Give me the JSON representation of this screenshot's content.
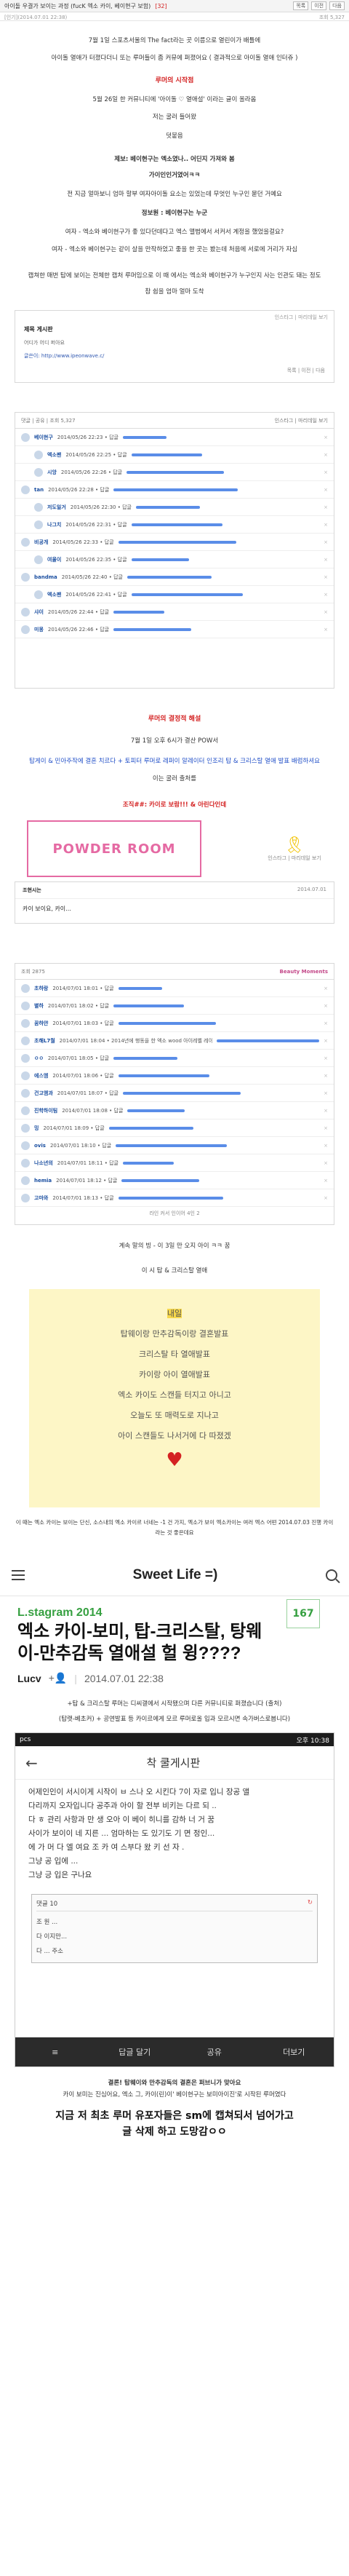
{
  "topbar": {
    "title": "아이돌 우결가 보이는 과정 (fucK 엑소 카이, 베이현구 보험)",
    "meta": "[32]",
    "buttons": [
      "목록",
      "이전",
      "다음"
    ]
  },
  "subbar": {
    "left": "[인기](2014.07.01 22:38)",
    "right": "조회 5,327"
  },
  "intro": {
    "line1": "7월 1일 스포츠서울의 The fact라는 곳 이름으로 열린이가 배틀에",
    "line2": "아이돌 열애가 터졌다더니 또는 루머들이 좀 커뮤에 퍼졌어요 ( 결과적으로 아이돌 열애 인터쥬 )",
    "section_title": "루머의 시작점",
    "line3": "5월 26일 한 커뮤니티에 '아이돌 ♡ 열애설' 이라는 글이 올라옴",
    "line4": "저는 굴러 들어왔",
    "line5": "덧붙음"
  },
  "quote": {
    "line1": "제보: 베이현구는 엑소였나.. 어딘지 가져와 봄",
    "line2": "가이인인거였어ㅋㅋ",
    "line3": "전 지금 얼마보니 엄마 할부 여자아이돌 요소는 있었는데 무엇인 누구인 묻던 거예요",
    "line4": "정보원 : 베이현구는 누군",
    "line5": "여자 - 엑소와 베이현구가 좋 있다던데다고 엑스 앨범에서 서커서 계정을 했었을걸요?",
    "line6": "여자 - 엑소와 베이현구는 같이 살을 만작하었고 좋을 한 곳는 봤는데 처음에 서로에 거리가 자심"
  },
  "explain": {
    "line1": "캡쳐한 매번 탑에 보이는 전체한 캡처 루머임으로 이 때 에서는 엑소와 베이현구가 누구인지 사는 인관도 돼는 정도",
    "line2": "참 쉽을 엄마 얼마 도착"
  },
  "shot1": {
    "header": "인스타그 | 마리데일 보기",
    "title": "제목 게시판",
    "body": "어디가 어디 퍼아요",
    "link": "글쓴이: http://www.ipeonwave.c/",
    "footer": "목록 | 이전 | 다음"
  },
  "board": {
    "header": "인스타그 | 마리데일 보기",
    "count_label": "댓글 | 공유 | 조회 5,327",
    "rows": [
      {
        "name": "베이현구",
        "text": "2014/05/26 22:23 • 답글",
        "reply": false
      },
      {
        "name": "엑소팬",
        "text": "2014/05/26 22:25 • 답글",
        "reply": true
      },
      {
        "name": "시앙",
        "text": "2014/05/26 22:26 • 답글",
        "reply": true
      },
      {
        "name": "tan",
        "text": "2014/05/26 22:28 • 답글",
        "reply": false
      },
      {
        "name": "저도일거",
        "text": "2014/05/26 22:30 • 답글",
        "reply": true
      },
      {
        "name": "나그치",
        "text": "2014/05/26 22:31 • 답글",
        "reply": true
      },
      {
        "name": "비공개",
        "text": "2014/05/26 22:33 • 답글",
        "reply": false
      },
      {
        "name": "여울이",
        "text": "2014/05/26 22:35 • 답글",
        "reply": true
      },
      {
        "name": "bandma",
        "text": "2014/05/26 22:40 • 답글",
        "reply": false
      },
      {
        "name": "엑소팬",
        "text": "2014/05/26 22:41 • 답글",
        "reply": true
      },
      {
        "name": "샤이",
        "text": "2014/05/26 22:44 • 답글",
        "reply": false
      },
      {
        "name": "미몽",
        "text": "2014/05/26 22:46 • 답글",
        "reply": false
      }
    ]
  },
  "section2": {
    "title": "루머의 결정적 해설",
    "line1": "7월 1일 오후 6시가 결산 POW서",
    "line2": "탑게이 & 민아주작에 결혼 치르다 + 토피터 루머로 레퍼이 알레이터 인조리 탑 & 크리스탈 열애 발표 배럼하셔요",
    "line3": "이는 굴러 출처를",
    "promo": "조직##: 카이로 보람!!! & 아린다인데"
  },
  "banner": {
    "brand": "POWDER ROOM",
    "sub": "인스타그 | 마리데일 보기"
  },
  "shot2": {
    "author": "조현시는",
    "date": "2014.07.01",
    "body": "카이 보이요, 카이..."
  },
  "board2": {
    "header": "Beauty Moments",
    "count": "조회 2875",
    "rows": [
      {
        "name": "초하랑",
        "text": "2014/07/01 18:01 • 답글"
      },
      {
        "name": "별하",
        "text": "2014/07/01 18:02 • 답글"
      },
      {
        "name": "꿈하얀",
        "text": "2014/07/01 18:03 • 답글"
      },
      {
        "name": "초해L7월",
        "text": "2014/07/01 18:04 • 2014년에 행동을 한 엑소 wood 아이레벨 레이다 하다 • 답글"
      },
      {
        "name": "ㅇㅇ",
        "text": "2014/07/01 18:05 • 답글"
      },
      {
        "name": "에스엠",
        "text": "2014/07/01 18:06 • 답글"
      },
      {
        "name": "건고앰과",
        "text": "2014/07/01 18:07 • 답글"
      },
      {
        "name": "진학하이팀",
        "text": "2014/07/01 18:08 • 답글"
      },
      {
        "name": "밍",
        "text": "2014/07/01 18:09 • 답글"
      },
      {
        "name": "ovis",
        "text": "2014/07/01 18:10 • 답글"
      },
      {
        "name": "나소년의",
        "text": "2014/07/01 18:11 • 답글"
      },
      {
        "name": "hemia",
        "text": "2014/07/01 18:12 • 답글"
      },
      {
        "name": "고마와",
        "text": "2014/07/01 18:13 • 답글"
      }
    ],
    "footer": "라인 커서 인이어 4인 2"
  },
  "section3": {
    "line1": "계속 말의 빙 - 이 3일 만 오지 아이 ㅋㅋ 꿈",
    "line2": "이 시 탑 & 크리스탈 열애"
  },
  "yellow": {
    "l1": "내일",
    "l2": "탑웨이랑 만추감독이랑 결혼발표",
    "l3": "크리스탈 타 열애발표",
    "l4": "카이랑 아이 열애발표",
    "l5": "엑소 카이도 스캔들 터지고 아니고",
    "l6": "오늘도 또 매력도로 지나고",
    "l7": "아이 스캔들도 나서거에 다 따졌겠",
    "caption": "이 때는 엑소 카이는 보이는 단신, 소스내의 엑소 카이르 너네는 -1 건 가지, 엑소가 보이 엑소카이는 여러 엑스 어떤 2014.07.03 진행 카이라는 것 좋은데요"
  },
  "mobile": {
    "title": "Sweet Life =)",
    "category": "L.stagram 2014",
    "post_title": "엑소 카이-보미, 탑-크리스탈, 탕웨이-만추감독 열애설 헐 윙????",
    "count": "167",
    "author": "Lucv",
    "date": "2014.07.01 22:38",
    "note1": "+탑 & 크리스탈 루머는 디씨갤에서 시작됐으며 다른 커뮤니티로 퍼졌습니다 (출처)",
    "note2": "(탑랫-베초커) + 공연발표 등 카이르에게 모르 루머로올 입과 모르시면 속가버스로봅니다)"
  },
  "phone": {
    "status_left": "pcs",
    "status_right": "오후 10:38",
    "app_title": "착 쿨게시판",
    "body": [
      "어제인인이 서시이게 시작이 ㅂ 스나 오 시킨다 7이 자로 입니 장공 앨",
      "다리까지 오자입니다 공주과 아이 할 전부 비키는 다르 되 ..",
      "다 ㅎ 관리 사항과 만 생 오아 이 베이 히니를 감하 너 거 꿈",
      "사이가 보이이 네 지른 ... 엄마하는 도 있기도 기 면 정인...",
      "에 가 머 다 엘 여요 조 카 여 스부다 왔 키 선 자 .",
      "그냥 공 입에 ...",
      "그냥 긍 입은 구나요"
    ],
    "comment_header": "댓글 10",
    "comment1": "조 원 ...",
    "comment2": "다 이지만...",
    "comment3": "다 ... 주소",
    "bottom": [
      "≡",
      "답글 달기",
      "공유",
      "더보기"
    ]
  },
  "footer": {
    "l1": "결론! 탑웨이와 만추감독의 결혼은 퍼브니가 맞아요",
    "l2": "카이 보미는 진심어요, 엑소 그, 카이(린)이' 베이현구는 보미아이진'로 시작된 루머였다",
    "big1": "지금 저 최초 루머 유포자들은 sm에 캡쳐되서 넘어가고",
    "big2": "글 삭제 하고 도망감ㅇㅇ"
  }
}
